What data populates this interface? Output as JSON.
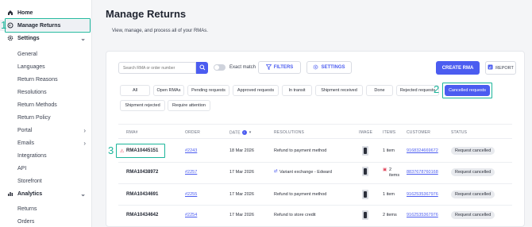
{
  "sidebar": {
    "home": "Home",
    "manage_returns": "Manage Returns",
    "settings": "Settings",
    "settings_items": [
      "General",
      "Languages",
      "Return Reasons",
      "Resolutions",
      "Return Methods",
      "Return Policy",
      "Portal",
      "Emails",
      "Integrations",
      "API",
      "Storefront"
    ],
    "analytics": "Analytics",
    "analytics_items": [
      "Returns",
      "Orders"
    ]
  },
  "callouts": {
    "one": "1",
    "two": "2",
    "three": "3"
  },
  "header": {
    "title": "Manage Returns",
    "subtitle": "View, manage, and process all of your RMAs."
  },
  "toolbar": {
    "search_placeholder": "Search RMA or order number",
    "exact_match": "Exact match",
    "filters": "FILTERS",
    "settings": "SETTINGS",
    "create_rma": "CREATE RMA",
    "report": "REPORT"
  },
  "filters": [
    "All",
    "Open RMAs",
    "Pending requests",
    "Approved requests",
    "In transit",
    "Shipment received",
    "Done",
    "Rejected requests",
    "Cancelled requests",
    "Shipment rejected",
    "Require attention"
  ],
  "table": {
    "headers": {
      "rma": "RMA#",
      "order": "ORDER",
      "date": "DATE",
      "resolutions": "RESOLUTIONS",
      "image": "IMAGE",
      "items": "ITEMS",
      "customer": "CUSTOMER",
      "status": "STATUS"
    },
    "rows": [
      {
        "rma": "RMA10445151",
        "order": "#2243",
        "date": "18 Mar 2026",
        "resolution": "Refund to payment method",
        "items": "1 item",
        "customer": "9168324669672",
        "status": "Request cancelled"
      },
      {
        "rma": "RMA10438972",
        "order": "#2257",
        "date": "17 Mar 2026",
        "resolution": "Variant exchange - Edward",
        "items": "2 items",
        "customer": "8837678760168",
        "status": "Request cancelled"
      },
      {
        "rma": "RMA10434691",
        "order": "#2255",
        "date": "17 Mar 2026",
        "resolution": "Refund to payment method",
        "items": "1 item",
        "customer": "9162535367976",
        "status": "Request cancelled"
      },
      {
        "rma": "RMA10434642",
        "order": "#2254",
        "date": "17 Mar 2026",
        "resolution": "Refund to store credit",
        "items": "2 items",
        "customer": "9162535367976",
        "status": "Request cancelled"
      }
    ]
  },
  "colors": {
    "accent": "#4b5cf0",
    "callout": "#1bb59a"
  }
}
